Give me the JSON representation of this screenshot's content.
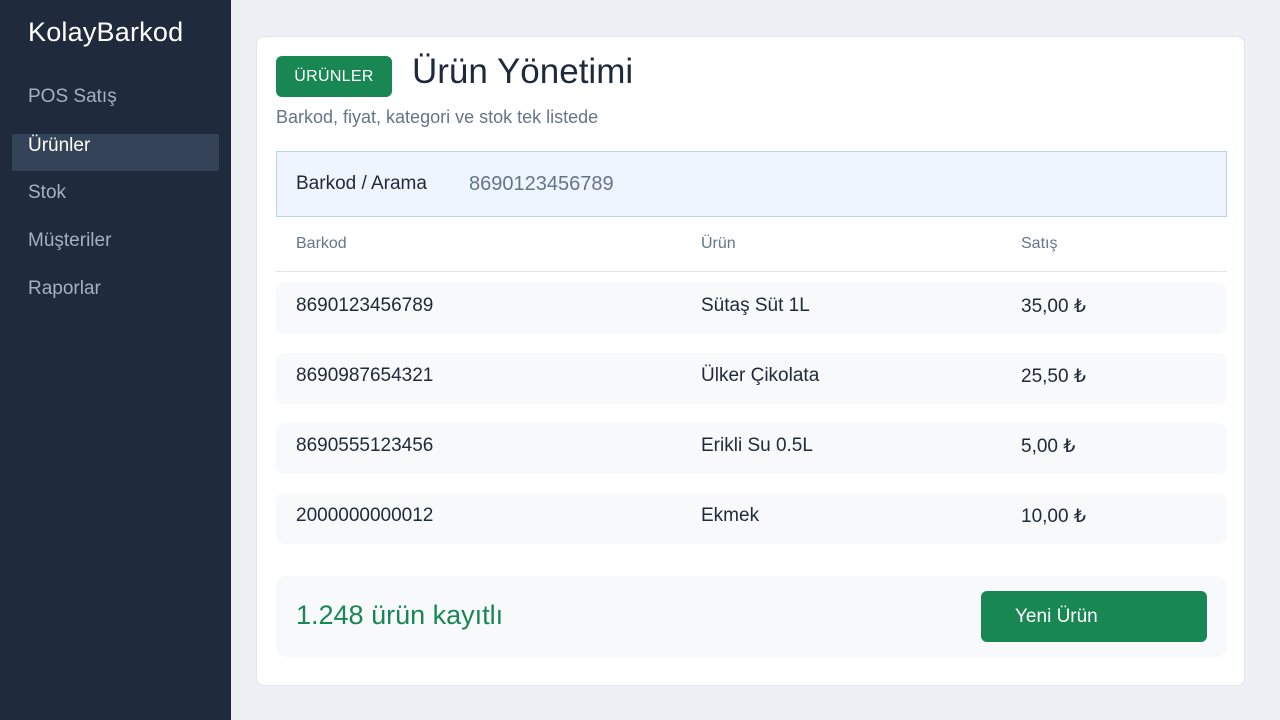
{
  "app": {
    "brand": "KolayBarkod"
  },
  "sidebar": {
    "items": [
      {
        "label": "POS Satış",
        "active": false
      },
      {
        "label": "Ürünler",
        "active": true
      },
      {
        "label": "Stok",
        "active": false
      },
      {
        "label": "Müşteriler",
        "active": false
      },
      {
        "label": "Raporlar",
        "active": false
      }
    ]
  },
  "page": {
    "badge": "ÜRÜNLER",
    "title": "Ürün Yönetimi",
    "subtitle": "Barkod, fiyat, kategori ve stok tek listede"
  },
  "search": {
    "label": "Barkod / Arama",
    "value": "8690123456789"
  },
  "table": {
    "headers": [
      "Barkod",
      "Ürün",
      "Satış"
    ],
    "rows": [
      {
        "barcode": "8690123456789",
        "product": "Sütaş Süt 1L",
        "price": "35,00 ₺"
      },
      {
        "barcode": "8690987654321",
        "product": "Ülker Çikolata",
        "price": "25,50 ₺"
      },
      {
        "barcode": "8690555123456",
        "product": "Erikli Su 0.5L",
        "price": "5,00 ₺"
      },
      {
        "barcode": "2000000000012",
        "product": "Ekmek",
        "price": "10,00 ₺"
      }
    ]
  },
  "footer": {
    "count_text": "1.248 ürün kayıtlı",
    "new_button": "Yeni Ürün"
  },
  "colors": {
    "sidebar_bg": "#1f2a3c",
    "accent_green": "#198754",
    "search_bg": "#eef5fe",
    "page_bg": "#edf1f6"
  }
}
